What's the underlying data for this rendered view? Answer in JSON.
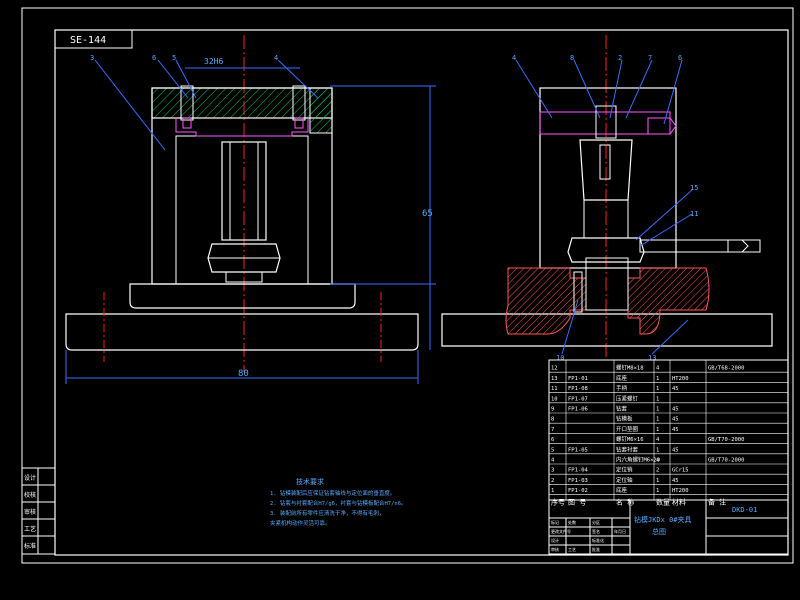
{
  "drawing": {
    "code": "SE-144",
    "title_line1": "钻模JKDx 0#夹具",
    "title_line2": "总图",
    "drawing_no": "DKD-01",
    "dim_top": "32H6",
    "dim_height": "65",
    "dim_width": "80",
    "colors": {
      "background": "#000000",
      "outline": "#ffffff",
      "centerline": "#ff2020",
      "hatch": "#00cc66",
      "leader": "#3a6bff",
      "section": "#ff5555",
      "text_white": "#ffffff",
      "text_blue": "#55aaff"
    }
  },
  "balloons": {
    "front": [
      "3",
      "6",
      "5",
      "4"
    ],
    "side": [
      "4",
      "8",
      "2",
      "7",
      "6",
      "15",
      "11",
      "10",
      "13"
    ]
  },
  "bom": {
    "headers": [
      "序号",
      "图 号",
      "名 称",
      "数量",
      "材料",
      "备 注"
    ],
    "rows": [
      {
        "no": "12",
        "code": "",
        "name": "螺钉M8×18",
        "qty": "4",
        "mat": "",
        "note": "GB/T68-2000"
      },
      {
        "no": "13",
        "code": "FP1-01",
        "name": "底座",
        "qty": "1",
        "mat": "HT200",
        "note": ""
      },
      {
        "no": "11",
        "code": "FP1-08",
        "name": "手柄",
        "qty": "1",
        "mat": "45",
        "note": ""
      },
      {
        "no": "10",
        "code": "FP1-07",
        "name": "压紧螺钉",
        "qty": "1",
        "mat": "",
        "note": ""
      },
      {
        "no": "9",
        "code": "FP1-06",
        "name": "钻套",
        "qty": "1",
        "mat": "45",
        "note": ""
      },
      {
        "no": "8",
        "code": "",
        "name": "钻模板",
        "qty": "1",
        "mat": "45",
        "note": ""
      },
      {
        "no": "7",
        "code": "",
        "name": "开口垫圈",
        "qty": "1",
        "mat": "45",
        "note": ""
      },
      {
        "no": "6",
        "code": "",
        "name": "螺钉M6×16",
        "qty": "4",
        "mat": "",
        "note": "GB/T70-2000"
      },
      {
        "no": "5",
        "code": "FP1-05",
        "name": "钻套衬套",
        "qty": "1",
        "mat": "45",
        "note": ""
      },
      {
        "no": "4",
        "code": "",
        "name": "内六角螺钉M6×20",
        "qty": "4",
        "mat": "",
        "note": "GB/T70-2000"
      },
      {
        "no": "3",
        "code": "FP1-04",
        "name": "定位销",
        "qty": "2",
        "mat": "GCr15",
        "note": ""
      },
      {
        "no": "2",
        "code": "FP1-03",
        "name": "定位轴",
        "qty": "1",
        "mat": "45",
        "note": ""
      },
      {
        "no": "1",
        "code": "FP1-02",
        "name": "底座",
        "qty": "1",
        "mat": "HT200",
        "note": ""
      }
    ]
  },
  "notes": {
    "title": "技术要求",
    "lines": [
      "1. 钻模装配后应保证钻套轴线与定位面的垂直度。",
      "2. 钻套与衬套配合H7/g6，衬套与钻模板配合H7/n6。",
      "3. 装配前所有零件应清洗干净，不得有毛刺，",
      "   夹紧机构动作灵活可靠。"
    ]
  },
  "side_stamp": [
    "设计",
    "校核",
    "审核",
    "工艺",
    "标准"
  ],
  "title_block": {
    "cells": [
      "标记",
      "处数",
      "分区",
      "更改文件号",
      "签名",
      "年月日",
      "设计",
      "标准化",
      "审核",
      "工艺",
      "批准"
    ]
  }
}
